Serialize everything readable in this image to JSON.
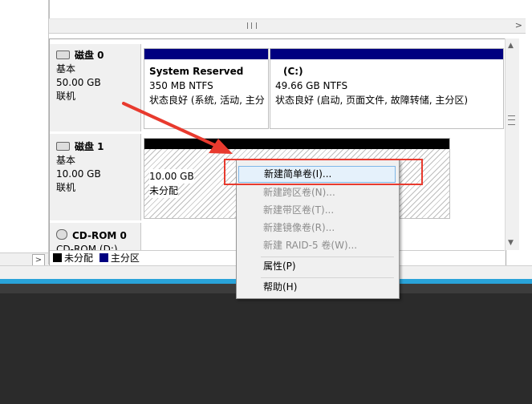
{
  "disks": [
    {
      "name": "磁盘 0",
      "type": "基本",
      "size": "50.00 GB",
      "status": "联机"
    },
    {
      "name": "磁盘 1",
      "type": "基本",
      "size": "10.00 GB",
      "status": "联机"
    },
    {
      "name": "CD-ROM 0",
      "type": "CD-ROM (D:)"
    }
  ],
  "volumes": {
    "sys_reserved": {
      "title": "System Reserved",
      "size": "350 MB NTFS",
      "status": "状态良好 (系统, 活动, 主分"
    },
    "c_drive": {
      "title": "(C:)",
      "size": "49.66 GB NTFS",
      "status": "状态良好 (启动, 页面文件, 故障转储, 主分区)"
    },
    "unallocated": {
      "size": "10.00 GB",
      "status": "未分配"
    }
  },
  "legend": [
    {
      "label": "未分配",
      "color": "#000000"
    },
    {
      "label": "主分区",
      "color": "#000080"
    }
  ],
  "context_menu": {
    "items": [
      {
        "label": "新建简单卷(I)...",
        "enabled": true,
        "highlighted": true
      },
      {
        "label": "新建跨区卷(N)...",
        "enabled": false
      },
      {
        "label": "新建带区卷(T)...",
        "enabled": false
      },
      {
        "label": "新建镜像卷(R)...",
        "enabled": false
      },
      {
        "label": "新建 RAID-5 卷(W)...",
        "enabled": false
      },
      {
        "label": "属性(P)",
        "enabled": true
      },
      {
        "label": "帮助(H)",
        "enabled": true
      }
    ]
  },
  "colors": {
    "annotation": "#e83a2e",
    "primary_partition": "#000080",
    "taskbar_accent": "#29a3d9"
  }
}
